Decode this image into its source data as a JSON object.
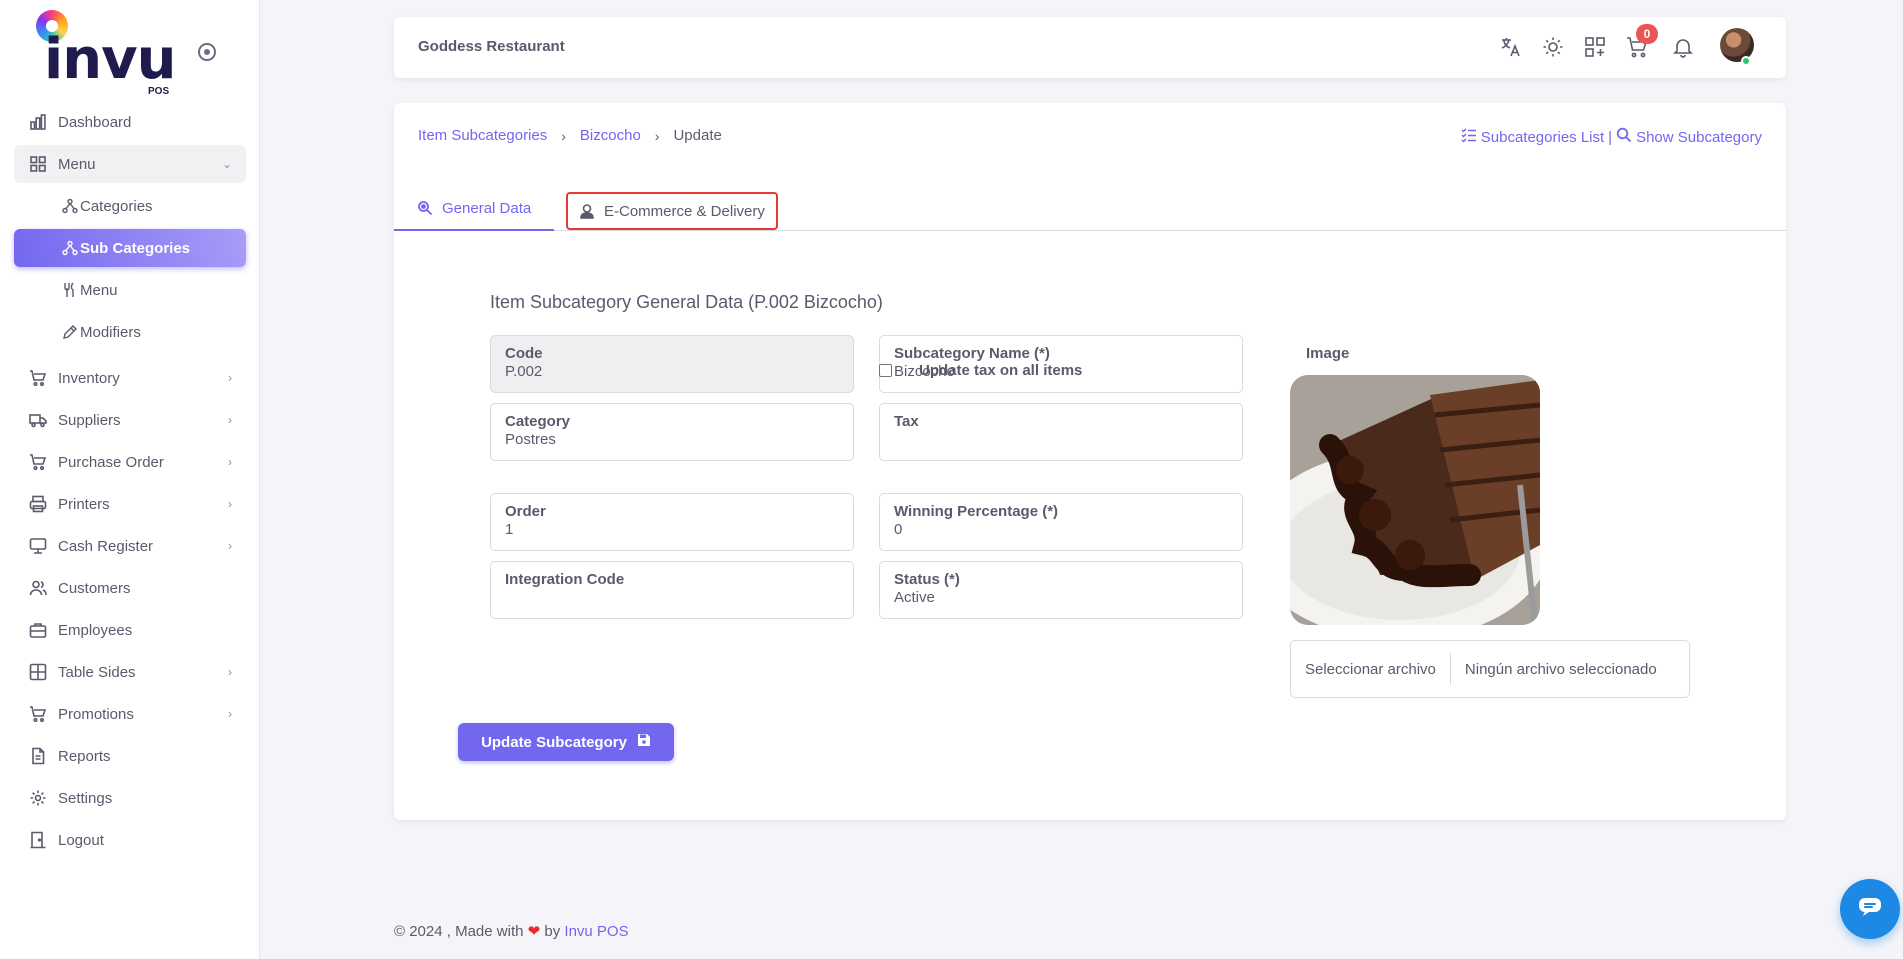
{
  "brand": {
    "logo_text": "invu",
    "logo_sub": "POS"
  },
  "sidebar": {
    "items": [
      {
        "label": "Dashboard",
        "icon": "chart-bar-icon"
      },
      {
        "label": "Menu",
        "icon": "grid-icon",
        "expanded": true
      },
      {
        "label": "Inventory",
        "icon": "cart-icon"
      },
      {
        "label": "Suppliers",
        "icon": "truck-icon"
      },
      {
        "label": "Purchase Order",
        "icon": "shopping-cart-icon"
      },
      {
        "label": "Printers",
        "icon": "printer-icon"
      },
      {
        "label": "Cash Register",
        "icon": "cash-register-icon"
      },
      {
        "label": "Customers",
        "icon": "users-icon"
      },
      {
        "label": "Employees",
        "icon": "briefcase-icon"
      },
      {
        "label": "Table Sides",
        "icon": "table-icon"
      },
      {
        "label": "Promotions",
        "icon": "cart-icon"
      },
      {
        "label": "Reports",
        "icon": "file-icon"
      },
      {
        "label": "Settings",
        "icon": "gear-icon"
      },
      {
        "label": "Logout",
        "icon": "door-icon"
      }
    ],
    "menu_sub": [
      {
        "label": "Categories"
      },
      {
        "label": "Sub Categories",
        "active": true
      },
      {
        "label": "Menu"
      },
      {
        "label": "Modifiers"
      }
    ]
  },
  "topbar": {
    "title": "Goddess Restaurant",
    "cart_count": "0"
  },
  "breadcrumb": {
    "root": "Item Subcategories",
    "parent": "Bizcocho",
    "current": "Update"
  },
  "header_links": {
    "list": "Subcategories List",
    "separator": "|",
    "show": "Show Subcategory"
  },
  "tabs": {
    "general": "General Data",
    "ecommerce": "E-Commerce & Delivery"
  },
  "form": {
    "section_title": "Item Subcategory General Data (P.002 Bizcocho)",
    "code": {
      "label": "Code",
      "value": "P.002"
    },
    "subcategory_name": {
      "label": "Subcategory Name (*)",
      "value": "Bizcocho"
    },
    "category": {
      "label": "Category",
      "value": "Postres"
    },
    "tax": {
      "label": "Tax",
      "value": ""
    },
    "update_tax_label": "Update tax on all items",
    "order": {
      "label": "Order",
      "value": "1"
    },
    "winning_percentage": {
      "label": "Winning Percentage (*)",
      "value": "0"
    },
    "integration_code": {
      "label": "Integration Code",
      "value": ""
    },
    "status": {
      "label": "Status (*)",
      "value": "Active"
    },
    "image_label": "Image",
    "file_button": "Seleccionar archivo",
    "file_name": "Ningún archivo seleccionado",
    "submit_label": "Update Subcategory"
  },
  "footer": {
    "prefix": "© 2024 , Made with",
    "by": "by",
    "link": "Invu POS"
  },
  "colors": {
    "accent": "#7367f0",
    "danger": "#ea5455",
    "highlight_border": "#e53935",
    "chat": "#1e88e5"
  }
}
